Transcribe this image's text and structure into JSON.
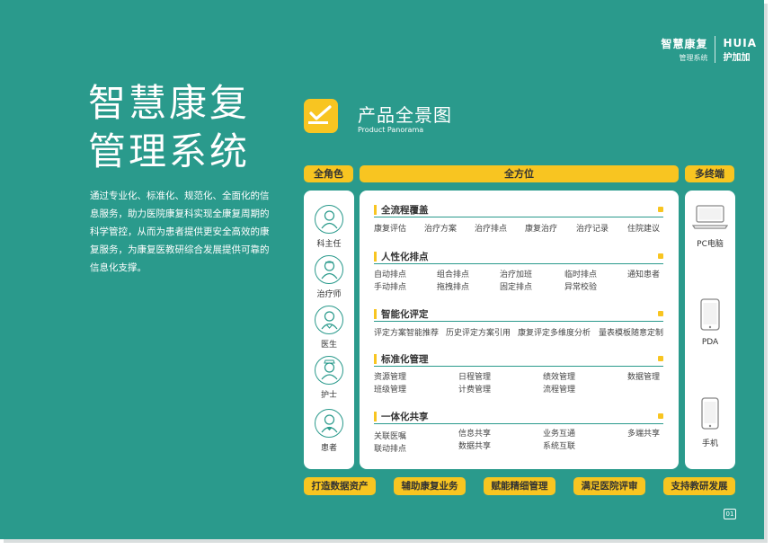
{
  "brand": {
    "title": "智慧康复",
    "subtitle": "管理系统",
    "logo": "HUIA",
    "logo_cn": "护加加"
  },
  "main_title": {
    "line1": "智慧康复",
    "line2": "管理系统"
  },
  "intro": "通过专业化、标准化、规范化、全面化的信息服务，助力医院康复科实现全康复周期的科学管控，从而为患者提供更安全高效的康复服务，为康复医教研综合发展提供可靠的信息化支撑。",
  "panorama": {
    "title": "产品全景图",
    "subtitle": "Product Panorama",
    "icon": "check-icon"
  },
  "bars": {
    "roles": "全角色",
    "scope": "全方位",
    "terminals": "多终端"
  },
  "roles": [
    {
      "label": "科主任",
      "icon": "doctor-head-icon"
    },
    {
      "label": "治疗师",
      "icon": "therapist-icon"
    },
    {
      "label": "医生",
      "icon": "doctor-icon"
    },
    {
      "label": "护士",
      "icon": "nurse-icon"
    },
    {
      "label": "患者",
      "icon": "patient-icon"
    }
  ],
  "sections": [
    {
      "title": "全流程覆盖",
      "items": [
        "康复评估",
        "治疗方案",
        "治疗排点",
        "康复治疗",
        "治疗记录",
        "住院建议"
      ]
    },
    {
      "title": "人性化排点",
      "items": [
        "自动排点",
        "组合排点",
        "治疗加班",
        "临时排点",
        "通知患者",
        "手动排点",
        "拖拽排点",
        "固定排点",
        "异常校验"
      ]
    },
    {
      "title": "智能化评定",
      "items": [
        "评定方案智能推荐",
        "历史评定方案引用",
        "康复评定多维度分析",
        "量表模板随意定制"
      ]
    },
    {
      "title": "标准化管理",
      "items": [
        "资源管理",
        "日程管理",
        "绩效管理",
        "数据管理",
        "班级管理",
        "计费管理",
        "流程管理"
      ]
    },
    {
      "title": "一体化共享",
      "items": [
        "关联医嘱",
        "信息共享",
        "业务互通",
        "多端共享",
        "联动排点",
        "数据共享",
        "系统互联"
      ]
    }
  ],
  "terminals": [
    {
      "label": "PC电脑",
      "icon": "laptop-icon"
    },
    {
      "label": "PDA",
      "icon": "pda-icon"
    },
    {
      "label": "手机",
      "icon": "phone-icon"
    }
  ],
  "bottom_buttons": [
    "打造数据资产",
    "辅助康复业务",
    "赋能精细管理",
    "满足医院评审",
    "支持教研发展"
  ],
  "page_number": "01",
  "colors": {
    "background": "#2a9a8c",
    "accent": "#f8c521",
    "panel": "#ffffff"
  }
}
